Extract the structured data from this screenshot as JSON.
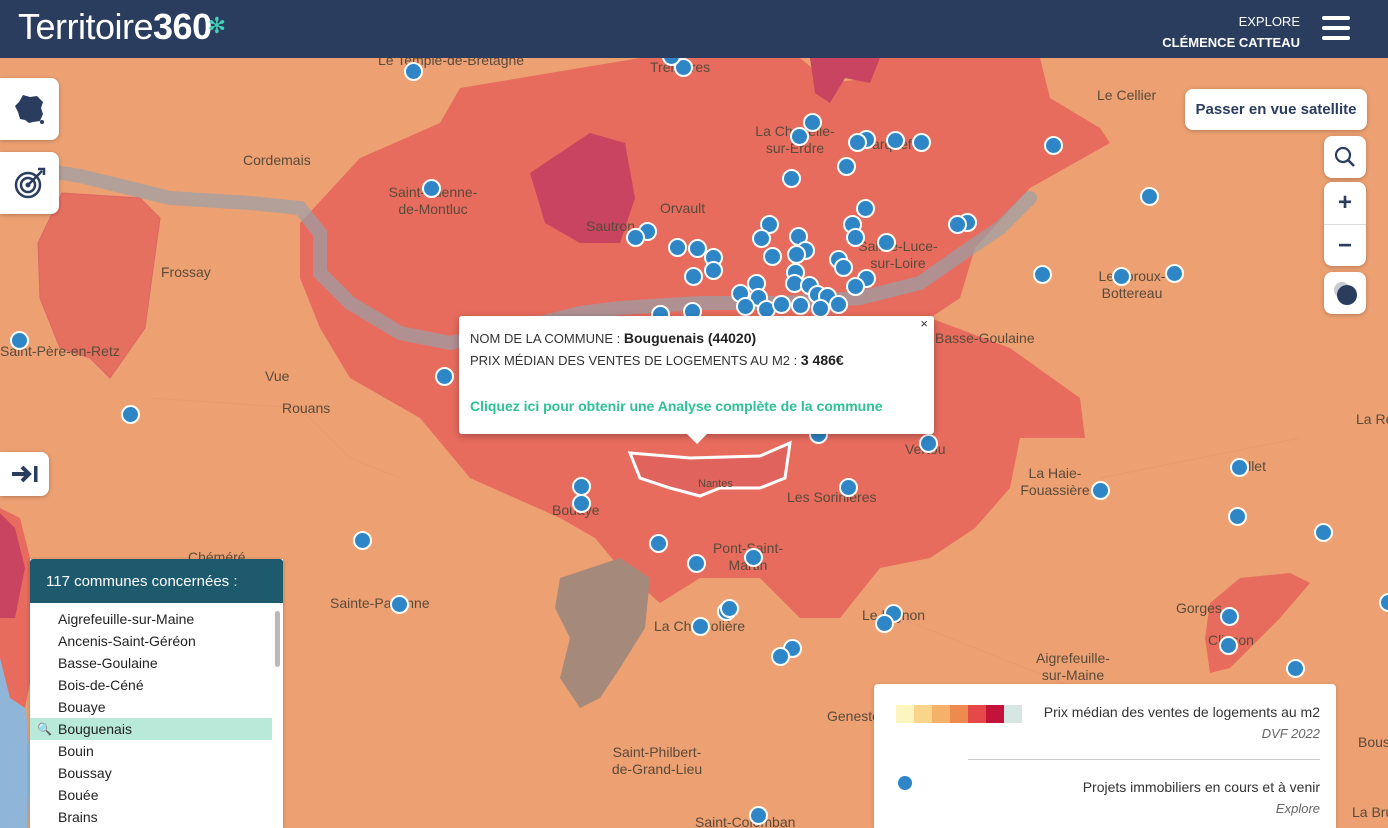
{
  "header": {
    "logo_text": "Territoire",
    "logo_num": "360",
    "user_line1": "EXPLORE",
    "user_line2": "CLÉMENCE CATTEAU"
  },
  "controls": {
    "satellite_label": "Passer en vue satellite",
    "zoom_in": "+",
    "zoom_out": "−"
  },
  "icons": {
    "france": "france-map-icon",
    "target": "target-icon",
    "collapse": "arrow-right-to-bar-icon",
    "search": "search-icon",
    "layers": "layers-circle-icon",
    "menu": "hamburger-menu-icon"
  },
  "popup": {
    "label1": "NOM DE LA COMMUNE :",
    "commune": "Bouguenais (44020)",
    "label2": "PRIX MÉDIAN DES VENTES DE LOGEMENTS AU M2 :",
    "price": "3 486€",
    "link": "Cliquez ici pour obtenir une Analyse complète de la commune",
    "close": "×"
  },
  "panel": {
    "title": "117 communes concernées :",
    "items": [
      "Aigrefeuille-sur-Maine",
      "Ancenis-Saint-Géréon",
      "Basse-Goulaine",
      "Bois-de-Céné",
      "Bouaye",
      "Bouguenais",
      "Bouin",
      "Boussay",
      "Bouée",
      "Brains"
    ],
    "selected": "Bouguenais"
  },
  "legend": {
    "title1": "Prix médian des ventes de logements au m2",
    "source1": "DVF 2022",
    "title2": "Projets immobiliers en cours et à venir",
    "source2": "Explore",
    "colors": [
      "#fdf5c0",
      "#f9d58a",
      "#f5b06a",
      "#ee8a4e",
      "#e44848",
      "#c4133b",
      "#d6e6e2"
    ],
    "dot_color": "#2f86c6"
  },
  "places": [
    "Le Temple-de-Bretagne",
    "Treillières",
    "Cordemais",
    "Saint-Étienne-de-Montluc",
    "La Chapelle-sur-Erdre",
    "Carquefou",
    "Le Cellier",
    "Sautron",
    "Orvault",
    "Frossay",
    "Sainte-Luce-sur-Loire",
    "Le Loroux-Bottereau",
    "Saint-Père-en-Retz",
    "Vue",
    "Rouans",
    "Basse-Goulaine",
    "Vertou",
    "La Haie-Fouassière",
    "Vallet",
    "La Remaudière",
    "Bouaye",
    "Les Sorinières",
    "Chéméré",
    "Pont-Saint-Martin",
    "Sainte-Pazanne",
    "La Chevrolière",
    "Le Bignon",
    "Gorges",
    "Clisson",
    "Aigrefeuille-sur-Maine",
    "Geneston",
    "Saint-Philbert-de-Grand-Lieu",
    "Saint-Colomban",
    "La Bruffière",
    "Boussay",
    "Nantes"
  ]
}
